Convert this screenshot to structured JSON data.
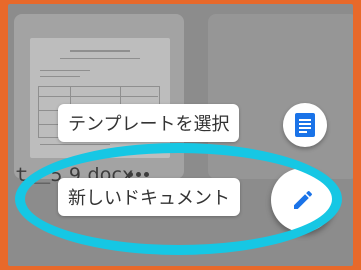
{
  "document": {
    "file_name": "ｔ＿5.9.docx"
  },
  "speed_dial": {
    "template_label": "テンプレートを選択",
    "new_doc_label": "新しいドキュメント",
    "template_icon": "document-icon",
    "new_doc_icon": "pencil-icon"
  },
  "colors": {
    "accent": "#1a73e8",
    "highlight": "#16c7e4",
    "frame": "#e8692a"
  }
}
